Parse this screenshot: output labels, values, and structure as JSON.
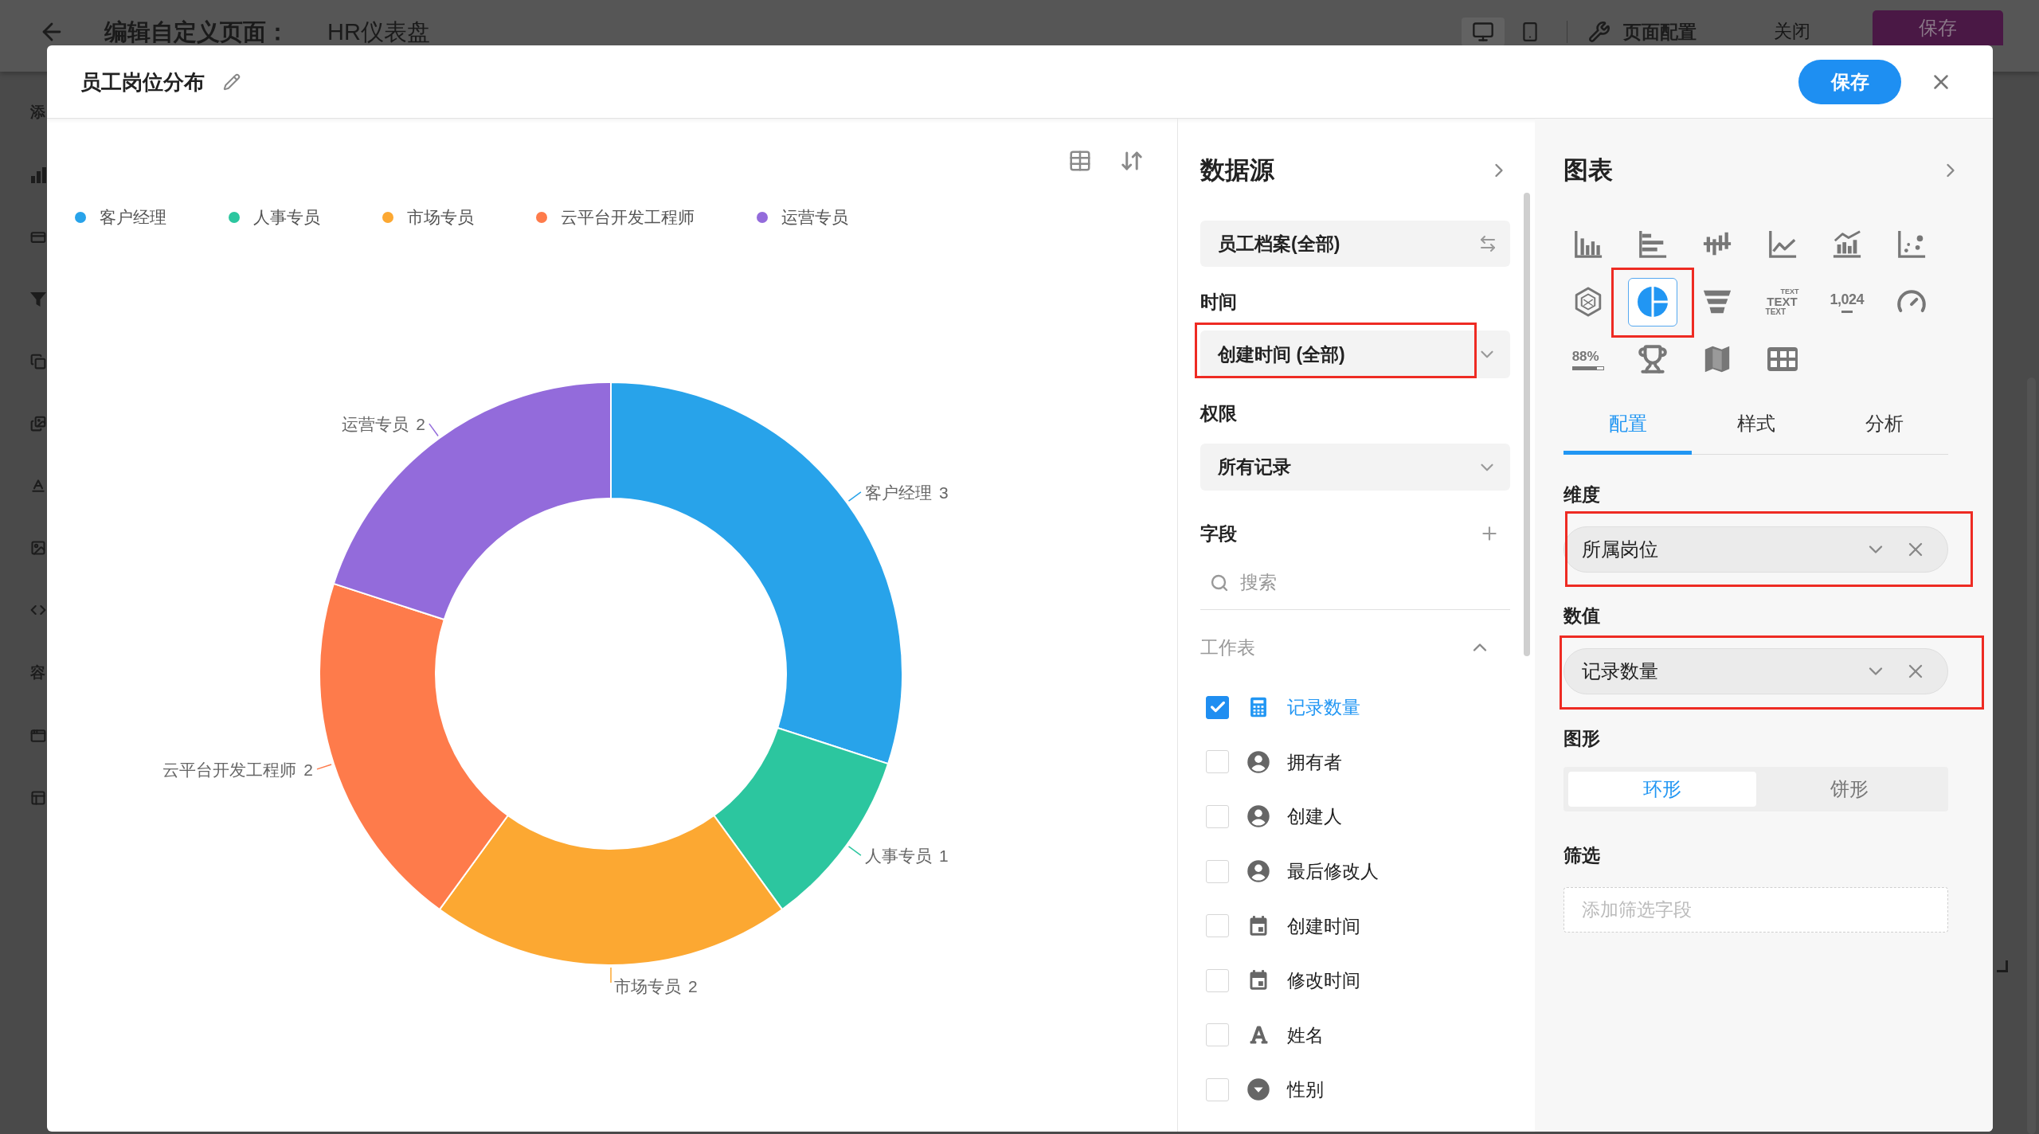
{
  "background_page": {
    "top_bar": {
      "title": "编辑自定义页面：",
      "page_name": "HR仪表盘",
      "device_options": [
        {
          "kind": "desktop",
          "selected": true
        },
        {
          "kind": "mobile",
          "selected": false
        }
      ],
      "config": "页面配置",
      "close_button": "关闭",
      "save_button": "保存"
    },
    "sidebar": [
      {
        "kind": "text",
        "label": "添"
      },
      {
        "kind": "bar-chart"
      },
      {
        "kind": "card"
      },
      {
        "kind": "filter"
      },
      {
        "kind": "copy"
      },
      {
        "kind": "images"
      },
      {
        "kind": "text-format"
      },
      {
        "kind": "image"
      },
      {
        "kind": "code"
      },
      {
        "kind": "text",
        "label": "容"
      },
      {
        "kind": "browser"
      },
      {
        "kind": "layout"
      }
    ]
  },
  "dialog": {
    "title": "员工岗位分布",
    "save_button": "保存"
  },
  "chart_preview": {
    "legend": [
      {
        "label": "客户经理",
        "color": "#28a3ea"
      },
      {
        "label": "人事专员",
        "color": "#2cc69f"
      },
      {
        "label": "市场专员",
        "color": "#fca832"
      },
      {
        "label": "云平台开发工程师",
        "color": "#fe7b4b"
      },
      {
        "label": "运营专员",
        "color": "#936bdb"
      }
    ],
    "chart_data": {
      "type": "donut",
      "categories": [
        "客户经理",
        "人事专员",
        "市场专员",
        "云平台开发工程师",
        "运营专员"
      ],
      "values": [
        3,
        1,
        2,
        2,
        2
      ],
      "data_labels": true
    }
  },
  "data_source": {
    "title": "数据源",
    "source": "员工档案(全部)",
    "time": {
      "label": "时间",
      "value": "创建时间 (全部)",
      "highlighted": true
    },
    "permission": {
      "label": "权限",
      "value": "所有记录"
    },
    "fields": {
      "label": "字段",
      "search": {
        "placeholder": "搜索"
      },
      "group": {
        "label": "工作表",
        "expanded": true
      },
      "items": [
        {
          "label": "记录数量",
          "kind": "number",
          "checked": true
        },
        {
          "label": "拥有者",
          "kind": "user",
          "checked": false
        },
        {
          "label": "创建人",
          "kind": "user",
          "checked": false
        },
        {
          "label": "最后修改人",
          "kind": "user",
          "checked": false
        },
        {
          "label": "创建时间",
          "kind": "date",
          "checked": false
        },
        {
          "label": "修改时间",
          "kind": "date",
          "checked": false
        },
        {
          "label": "姓名",
          "kind": "text",
          "checked": false
        },
        {
          "label": "性别",
          "kind": "option",
          "checked": false
        }
      ]
    }
  },
  "chart_settings": {
    "title": "图表",
    "chart_types": [
      {
        "kind": "bar",
        "selected": false,
        "highlighted": false
      },
      {
        "kind": "horizontal-bar",
        "selected": false,
        "highlighted": false
      },
      {
        "kind": "bidirectional-bar",
        "selected": false,
        "highlighted": false
      },
      {
        "kind": "line",
        "selected": false,
        "highlighted": false
      },
      {
        "kind": "combo",
        "selected": false,
        "highlighted": false
      },
      {
        "kind": "scatter",
        "selected": false,
        "highlighted": false
      },
      {
        "kind": "radar",
        "selected": false,
        "highlighted": false
      },
      {
        "kind": "pie",
        "selected": true,
        "highlighted": true
      },
      {
        "kind": "funnel",
        "selected": false,
        "highlighted": false
      },
      {
        "kind": "text",
        "label": [
          "TEXT",
          "TEXT",
          "TEXT"
        ],
        "selected": false,
        "highlighted": false
      },
      {
        "kind": "number",
        "label": "1,024",
        "selected": false,
        "highlighted": false
      },
      {
        "kind": "gauge",
        "selected": false,
        "highlighted": false
      },
      {
        "kind": "progress",
        "label": "88%",
        "selected": false,
        "highlighted": false
      },
      {
        "kind": "ranking",
        "selected": false,
        "highlighted": false
      },
      {
        "kind": "map",
        "selected": false,
        "highlighted": false
      },
      {
        "kind": "table",
        "selected": false,
        "highlighted": false
      }
    ],
    "tabs": [
      {
        "label": "配置",
        "selected": true
      },
      {
        "label": "样式",
        "selected": false
      },
      {
        "label": "分析",
        "selected": false
      }
    ],
    "dimension": {
      "label": "维度",
      "value": "所属岗位",
      "highlighted": true
    },
    "metric": {
      "label": "数值",
      "value": "记录数量",
      "highlighted": true
    },
    "shape": {
      "label": "图形",
      "options": [
        {
          "label": "环形",
          "selected": true
        },
        {
          "label": "饼形",
          "selected": false
        }
      ]
    },
    "filter": {
      "label": "筛选",
      "placeholder": "添加筛选字段"
    }
  }
}
